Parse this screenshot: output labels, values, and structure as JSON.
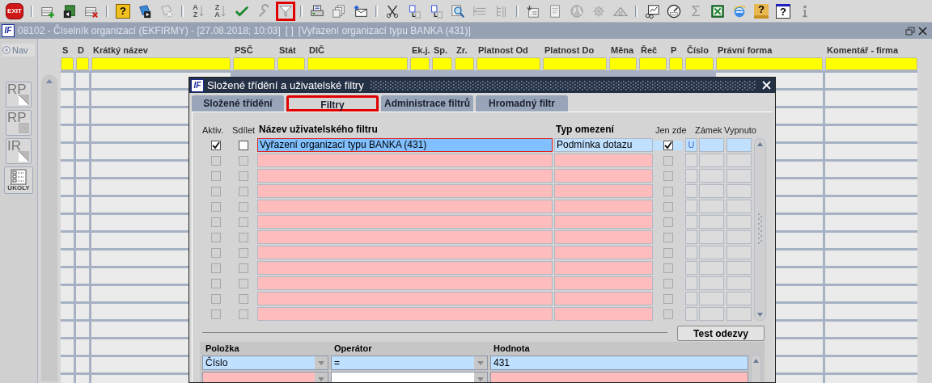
{
  "toolbar": [
    {
      "kind": "exit",
      "label": "EXIT",
      "highlighted": false
    },
    {
      "kind": "separator"
    },
    {
      "kind": "grid-add",
      "highlighted": false
    },
    {
      "kind": "grid-nav",
      "highlighted": false
    },
    {
      "kind": "grid-delete",
      "highlighted": false
    },
    {
      "kind": "separator"
    },
    {
      "kind": "doc-help",
      "label": "?",
      "highlighted": false
    },
    {
      "kind": "doc-play",
      "highlighted": false
    },
    {
      "kind": "doc-delete",
      "highlighted": false
    },
    {
      "kind": "separator"
    },
    {
      "kind": "sort",
      "label": "AZ",
      "highlighted": false
    },
    {
      "kind": "sort",
      "label": "ZA",
      "highlighted": false
    },
    {
      "kind": "check",
      "highlighted": false
    },
    {
      "kind": "wrench",
      "highlighted": false
    },
    {
      "kind": "filter",
      "highlighted": true
    },
    {
      "kind": "separator"
    },
    {
      "kind": "printer",
      "highlighted": false
    },
    {
      "kind": "copies",
      "highlighted": false
    },
    {
      "kind": "mail",
      "highlighted": false
    },
    {
      "kind": "separator"
    },
    {
      "kind": "scissors",
      "highlighted": false
    },
    {
      "kind": "text-swap",
      "highlighted": false
    },
    {
      "kind": "text-swap",
      "highlighted": false
    },
    {
      "kind": "magnifier",
      "highlighted": false
    },
    {
      "kind": "indent",
      "highlighted": false
    },
    {
      "kind": "tree",
      "highlighted": false
    },
    {
      "kind": "separator"
    },
    {
      "kind": "import",
      "highlighted": false
    },
    {
      "kind": "page",
      "highlighted": false
    },
    {
      "kind": "globe",
      "highlighted": false
    },
    {
      "kind": "wheel",
      "highlighted": false
    },
    {
      "kind": "roof",
      "highlighted": false
    },
    {
      "kind": "separator"
    },
    {
      "kind": "chart",
      "highlighted": false
    },
    {
      "kind": "gauge",
      "highlighted": false
    },
    {
      "kind": "sum",
      "label": "Σ",
      "highlighted": false
    },
    {
      "kind": "excel",
      "highlighted": false
    },
    {
      "kind": "browser",
      "highlighted": false
    },
    {
      "kind": "help-lock",
      "label": "?",
      "highlighted": false
    },
    {
      "kind": "help-window",
      "label": "?",
      "highlighted": false
    },
    {
      "kind": "info",
      "highlighted": false
    }
  ],
  "window": {
    "logo": "IF",
    "title": "08102 - Číselník organizací (EKFIRMY) - [27.08.2018; 10:03]",
    "marker": "[ ]",
    "filter": "[Vyřazení organizací typu BANKA (431)]"
  },
  "sidebar": {
    "nav_label": "Nav",
    "nav_selected": false,
    "buttons": [
      {
        "kind": "report",
        "label": "RP"
      },
      {
        "kind": "report-grid",
        "label": "RP"
      },
      {
        "kind": "report",
        "label": "IR"
      },
      {
        "kind": "tasks",
        "label": "ÚKOLY"
      }
    ]
  },
  "grid": {
    "columns": [
      "S",
      "D",
      "Krátký název",
      "PSČ",
      "Stát",
      "DIČ",
      "Ek.j.",
      "Sp.",
      "Zr.",
      "Platnost Od",
      "Platnost Do",
      "Měna",
      "Řeč",
      "P",
      "Číslo",
      "Právní forma",
      "Komentář - firma"
    ]
  },
  "dialog": {
    "logo": "IF",
    "title": "Složené třídění a uživatelské filtry",
    "tabs": [
      {
        "label": "Složené třídění",
        "selected": false,
        "highlighted": false
      },
      {
        "label": "Filtry",
        "selected": true,
        "highlighted": true
      },
      {
        "label": "Administrace filtrů",
        "selected": false,
        "highlighted": false
      },
      {
        "label": "Hromadný filtr",
        "selected": false,
        "highlighted": false
      }
    ],
    "filters": {
      "columns": [
        "Aktiv.",
        "Sdílet",
        "Název uživatelského filtru",
        "Typ omezení",
        "Jen zde",
        "Zámek",
        "Vypnuto"
      ],
      "rows": [
        {
          "selected": true,
          "disabled": false,
          "active": true,
          "shared": false,
          "name": "Vyřazení organizací typu BANKA (431)",
          "type": "Podmínka dotazu",
          "local_only": true,
          "flag": "U"
        },
        {
          "selected": false,
          "disabled": true,
          "active": false,
          "shared": false,
          "local_only": false
        },
        {
          "selected": false,
          "disabled": true,
          "active": false,
          "shared": false,
          "local_only": false
        },
        {
          "selected": false,
          "disabled": true,
          "active": false,
          "shared": false,
          "local_only": false
        },
        {
          "selected": false,
          "disabled": true,
          "active": false,
          "shared": false,
          "local_only": false
        },
        {
          "selected": false,
          "disabled": true,
          "active": false,
          "shared": false,
          "local_only": false
        },
        {
          "selected": false,
          "disabled": true,
          "active": false,
          "shared": false,
          "local_only": false
        },
        {
          "selected": false,
          "disabled": true,
          "active": false,
          "shared": false,
          "local_only": false
        },
        {
          "selected": false,
          "disabled": true,
          "active": false,
          "shared": false,
          "local_only": false
        },
        {
          "selected": false,
          "disabled": true,
          "active": false,
          "shared": false,
          "local_only": false
        },
        {
          "selected": false,
          "disabled": true,
          "active": false,
          "shared": false,
          "local_only": false
        },
        {
          "selected": false,
          "disabled": true,
          "active": false,
          "shared": false,
          "local_only": false
        }
      ]
    },
    "test_button": "Test odezvy",
    "conditions": {
      "columns": [
        "Položka",
        "Operátor",
        "Hodnota"
      ],
      "rows": [
        {
          "selected": true,
          "item": "Číslo",
          "operator": "=",
          "value": "431"
        },
        {
          "selected": false
        }
      ]
    }
  }
}
